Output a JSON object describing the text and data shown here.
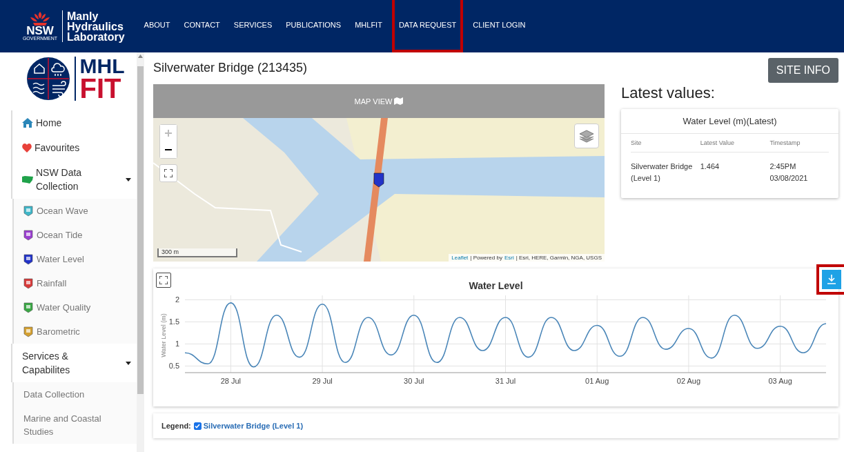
{
  "header": {
    "logo": {
      "badge": "NSW",
      "badge_sub": "GOVERNMENT",
      "name_lines": [
        "Manly",
        "Hydraulics",
        "Laboratory"
      ]
    },
    "nav": [
      {
        "label": "ABOUT",
        "highlighted": false
      },
      {
        "label": "CONTACT",
        "highlighted": false
      },
      {
        "label": "SERVICES",
        "highlighted": false
      },
      {
        "label": "PUBLICATIONS",
        "highlighted": false
      },
      {
        "label": "MHLFIT",
        "highlighted": false
      },
      {
        "label": "DATA REQUEST",
        "highlighted": true
      },
      {
        "label": "CLIENT LOGIN",
        "highlighted": false
      }
    ]
  },
  "sidebar": {
    "logo": {
      "line1": "MHL",
      "line2": "FIT"
    },
    "items": [
      {
        "label": "Home",
        "kind": "link"
      },
      {
        "label": "Favourites",
        "kind": "link"
      },
      {
        "label": "NSW Data Collection",
        "kind": "group",
        "expanded": true,
        "children": [
          {
            "label": "Ocean Wave",
            "color": "#3fb6c8"
          },
          {
            "label": "Ocean Tide",
            "color": "#9b3fd0"
          },
          {
            "label": "Water Level",
            "color": "#2233c8"
          },
          {
            "label": "Rainfall",
            "color": "#d83a3a"
          },
          {
            "label": "Water Quality",
            "color": "#3aa845"
          },
          {
            "label": "Barometric",
            "color": "#d4a030"
          }
        ]
      },
      {
        "label": "Services & Capabilites",
        "kind": "group",
        "expanded": true,
        "children": [
          {
            "label": "Data Collection"
          },
          {
            "label": "Marine and Coastal Studies"
          }
        ]
      }
    ]
  },
  "site_title": "Silverwater Bridge (213435)",
  "site_info_button": "SITE INFO",
  "map": {
    "header": "MAP VIEW",
    "scale": "300 m",
    "attribution_link": "Leaflet",
    "attribution_text": "| Powered by",
    "attribution_esri": "Esri",
    "attribution_rest": "| Esri, HERE, Garmin, NGA, USGS"
  },
  "latest": {
    "heading": "Latest values:",
    "card_title": "Water Level (m)(Latest)",
    "columns": [
      "Site",
      "Latest Value",
      "Timestamp"
    ],
    "rows": [
      [
        "Silverwater Bridge (Level 1)",
        "1.464",
        "2:45PM 03/08/2021"
      ]
    ]
  },
  "chart": {
    "download_highlighted": true,
    "chart_data": {
      "type": "line",
      "title": "Water Level",
      "ylabel": "Water Level (m)",
      "categories": [
        null,
        null,
        "28 Jul",
        null,
        null,
        null,
        "29 Jul",
        null,
        null,
        null,
        "30 Jul",
        null,
        null,
        null,
        "31 Jul",
        null,
        null,
        null,
        "01 Aug",
        null,
        null,
        null,
        "02 Aug",
        null,
        null,
        null,
        "03 Aug",
        null,
        null
      ],
      "series": [
        {
          "color": "#4a86b8",
          "values": [
            0.8,
            0.55,
            1.93,
            0.48,
            1.65,
            0.7,
            1.9,
            0.58,
            1.6,
            0.75,
            1.65,
            0.58,
            1.6,
            0.85,
            1.6,
            0.7,
            1.6,
            0.85,
            1.42,
            0.72,
            1.6,
            0.88,
            1.35,
            0.68,
            1.65,
            0.9,
            1.4,
            0.8,
            1.46
          ]
        }
      ],
      "ylim": [
        0.35,
        2.1
      ],
      "grid": true,
      "yticks": [
        0.5,
        1,
        1.5,
        2
      ]
    }
  },
  "legend": {
    "label": "Legend:",
    "items": [
      {
        "label": "Silverwater Bridge (Level 1)",
        "checked": true
      }
    ]
  }
}
